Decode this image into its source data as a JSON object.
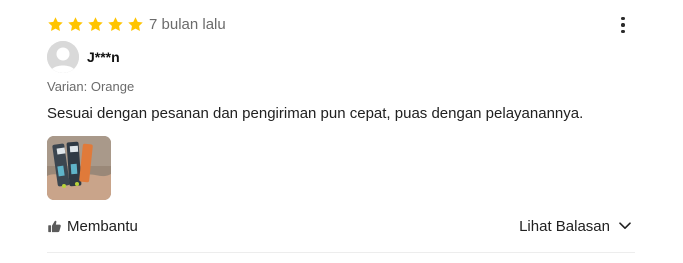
{
  "review": {
    "rating": 5,
    "max_rating": 5,
    "date": "7 bulan lalu",
    "reviewer_name": "J***n",
    "variant": "Varian: Orange",
    "text": "Sesuai dengan pesanan dan pengiriman pun cepat, puas dengan pelayanannya.",
    "photo_count": 1
  },
  "actions": {
    "helpful_label": "Membantu",
    "replies_label": "Lihat Balasan"
  },
  "colors": {
    "star": "#FFC400",
    "text_primary": "#212121",
    "text_secondary": "#6B6B6B",
    "avatar_bg": "#D9D9D9",
    "divider": "#EDEDED"
  },
  "icons": {
    "star": "star-icon",
    "menu": "more-vertical-icon",
    "helpful": "thumbs-up-icon",
    "replies": "chevron-down-icon",
    "avatar": "user-placeholder-icon"
  }
}
